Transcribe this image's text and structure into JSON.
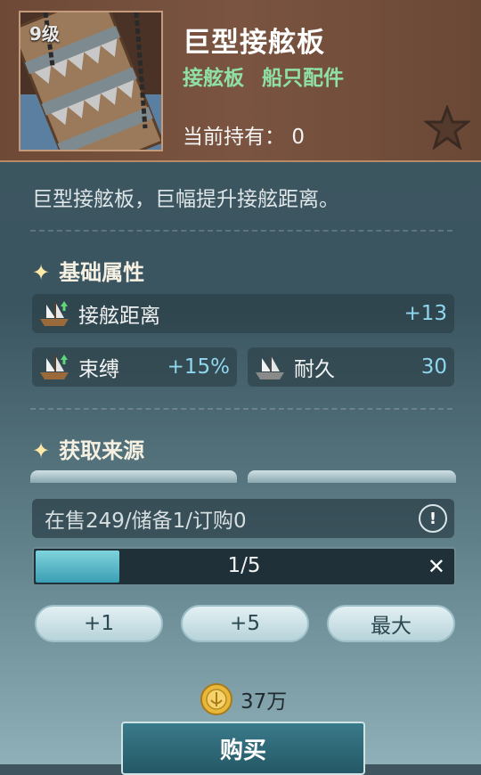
{
  "item": {
    "level": "9级",
    "name": "巨型接舷板",
    "tags": [
      "接舷板",
      "船只配件"
    ],
    "owned_label": "当前持有：",
    "owned_value": "0",
    "description": "巨型接舷板，巨幅提升接舷距离。"
  },
  "attributes": {
    "title": "基础属性",
    "rows": [
      {
        "name": "接舷距离",
        "value": "+13",
        "icon": "ship-upgrade-icon"
      },
      {
        "name": "束缚",
        "value": "+15%",
        "icon": "ship-upgrade-icon"
      },
      {
        "name": "耐久",
        "value": "30",
        "icon": "ship-icon"
      }
    ]
  },
  "sources": {
    "title": "获取来源"
  },
  "market": {
    "stock_text": "在售249/储备1/订购0",
    "quantity_text": "1/5",
    "quantity_fraction": 0.2,
    "buttons": [
      "+1",
      "+5",
      "最大"
    ],
    "price": "37万",
    "buy_label": "购买"
  },
  "colors": {
    "accent_green": "#8fe0a6",
    "value_blue": "#8fd6ee",
    "header_brown": "#7a5440"
  }
}
